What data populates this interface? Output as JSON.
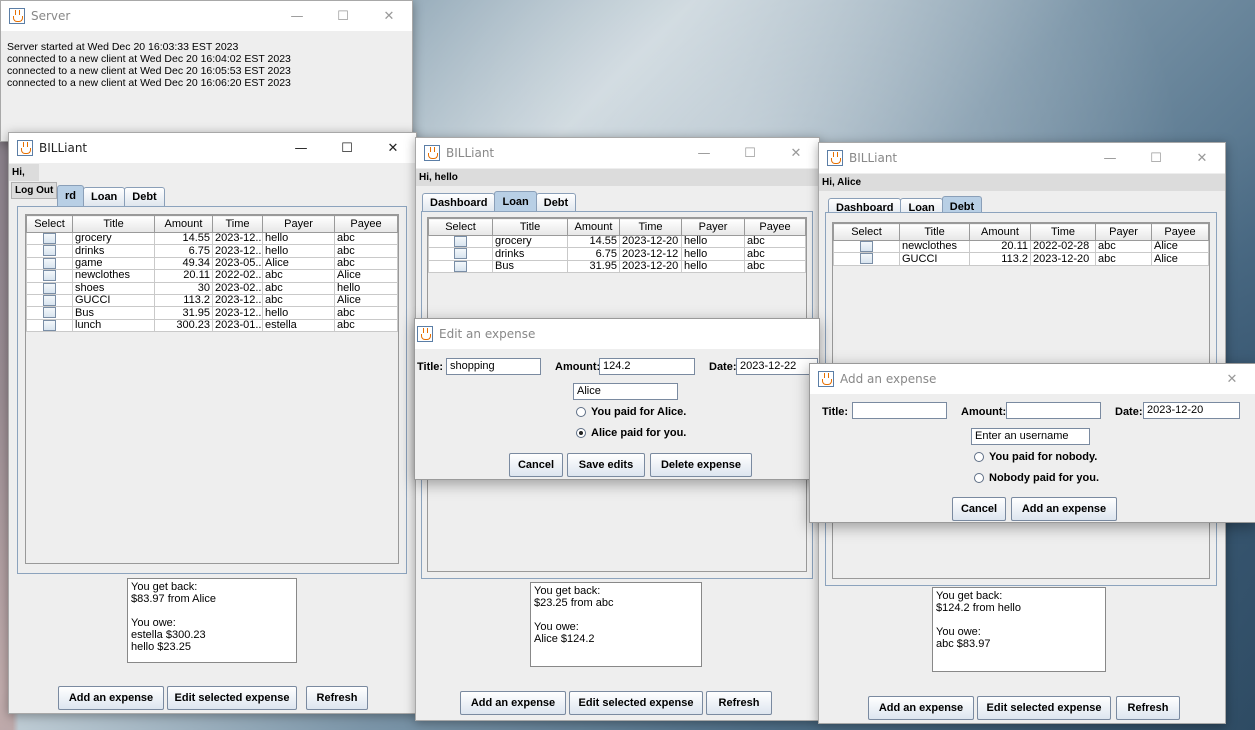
{
  "server": {
    "title": "Server",
    "log": [
      "Server started at Wed Dec 20 16:03:33 EST 2023",
      "connected to a new client at Wed Dec 20 16:04:02 EST 2023",
      "connected to a new client at Wed Dec 20 16:05:53 EST 2023",
      "connected to a new client at Wed Dec 20 16:06:20 EST 2023"
    ]
  },
  "titlebar_buttons": {
    "minimize": "—",
    "maximize": "☐",
    "close": "✕"
  },
  "columns": [
    "Select",
    "Title",
    "Amount",
    "Time",
    "Payer",
    "Payee"
  ],
  "tab_labels": {
    "dashboard": "Dashboard",
    "dashboard_partial": "rd",
    "loan": "Loan",
    "debt": "Debt"
  },
  "buttons": {
    "add": "Add an expense",
    "edit": "Edit selected expense",
    "refresh": "Refresh"
  },
  "windowA": {
    "title": "BILLiant",
    "greeting": "Hi, abc",
    "menu_item": "Log Out",
    "rows": [
      [
        "grocery",
        "14.55",
        "2023-12...",
        "hello",
        "abc"
      ],
      [
        "drinks",
        "6.75",
        "2023-12...",
        "hello",
        "abc"
      ],
      [
        "game",
        "49.34",
        "2023-05...",
        "Alice",
        "abc"
      ],
      [
        "newclothes",
        "20.11",
        "2022-02...",
        "abc",
        "Alice"
      ],
      [
        "shoes",
        "30",
        "2023-02...",
        "abc",
        "hello"
      ],
      [
        "GUCCI",
        "113.2",
        "2023-12...",
        "abc",
        "Alice"
      ],
      [
        "Bus",
        "31.95",
        "2023-12...",
        "hello",
        "abc"
      ],
      [
        "lunch",
        "300.23",
        "2023-01...",
        "estella",
        "abc"
      ]
    ],
    "summary": "You get back:\n$83.97 from Alice\n\nYou owe:\nestella $300.23\nhello $23.25"
  },
  "windowB": {
    "title": "BILLiant",
    "greeting": "Hi, hello",
    "rows": [
      [
        "grocery",
        "14.55",
        "2023-12-20",
        "hello",
        "abc"
      ],
      [
        "drinks",
        "6.75",
        "2023-12-12",
        "hello",
        "abc"
      ],
      [
        "Bus",
        "31.95",
        "2023-12-20",
        "hello",
        "abc"
      ]
    ],
    "summary": "You get back:\n$23.25 from abc\n\nYou owe:\nAlice $124.2"
  },
  "windowC": {
    "title": "BILLiant",
    "greeting": "Hi, Alice",
    "rows": [
      [
        "newclothes",
        "20.11",
        "2022-02-28",
        "abc",
        "Alice"
      ],
      [
        "GUCCI",
        "113.2",
        "2023-12-20",
        "abc",
        "Alice"
      ]
    ],
    "summary": "You get back:\n$124.2 from hello\n\nYou owe:\nabc $83.97"
  },
  "edit_dialog": {
    "title": "Edit an expense",
    "title_label": "Title:",
    "title_value": "shopping",
    "amount_label": "Amount:",
    "amount_value": "124.2",
    "date_label": "Date:",
    "date_value": "2023-12-22",
    "user_value": "Alice",
    "radio1": "You paid for Alice.",
    "radio2": "Alice paid for you.",
    "cancel": "Cancel",
    "save": "Save edits",
    "delete": "Delete expense"
  },
  "add_dialog": {
    "title": "Add an expense",
    "close": "✕",
    "title_label": "Title:",
    "title_value": "",
    "amount_label": "Amount:",
    "amount_value": "",
    "date_label": "Date:",
    "date_value": "2023-12-20",
    "user_placeholder": "Enter an username",
    "radio1": "You paid for nobody.",
    "radio2": "Nobody paid for you.",
    "cancel": "Cancel",
    "add": "Add an expense"
  }
}
